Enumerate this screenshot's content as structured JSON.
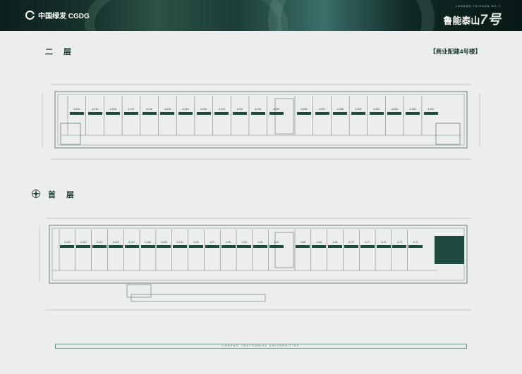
{
  "header": {
    "brand": "中国绿发 CGDG",
    "project_subtitle": "LUNENG TAISHAN NO.7",
    "project_name": "鲁能泰山",
    "project_number": "7号",
    "colors": {
      "header_dark": "#0d1f1d",
      "accent_green": "#1f4a3f",
      "page_bg": "#ebeeed"
    }
  },
  "building_tag": "【商业配建4号楼】",
  "floors": [
    {
      "title": "二 层",
      "units": [
        {
          "id": "4-220",
          "area": ""
        },
        {
          "id": "4-219",
          "area": ""
        },
        {
          "id": "4-218",
          "area": ""
        },
        {
          "id": "4-217",
          "area": ""
        },
        {
          "id": "4-216",
          "area": ""
        },
        {
          "id": "4-215",
          "area": ""
        },
        {
          "id": "4-214",
          "area": ""
        },
        {
          "id": "4-213",
          "area": ""
        },
        {
          "id": "4-212",
          "area": ""
        },
        {
          "id": "4-211",
          "area": ""
        },
        {
          "id": "4-210",
          "area": ""
        },
        {
          "id": "4-209",
          "area": ""
        },
        {
          "id": "4-208",
          "area": ""
        },
        {
          "id": "4-207",
          "area": ""
        },
        {
          "id": "4-206",
          "area": ""
        },
        {
          "id": "4-205",
          "area": ""
        },
        {
          "id": "4-204",
          "area": ""
        },
        {
          "id": "4-203",
          "area": ""
        },
        {
          "id": "4-202",
          "area": ""
        },
        {
          "id": "4-201",
          "area": ""
        }
      ]
    },
    {
      "title": "首 层",
      "units": [
        {
          "id": "4-115",
          "area": ""
        },
        {
          "id": "4-113",
          "area": ""
        },
        {
          "id": "4-111",
          "area": ""
        },
        {
          "id": "4-109",
          "area": ""
        },
        {
          "id": "4-107",
          "area": ""
        },
        {
          "id": "4-105",
          "area": ""
        },
        {
          "id": "4-103",
          "area": ""
        },
        {
          "id": "4-101",
          "area": ""
        },
        {
          "id": "4-99",
          "area": ""
        },
        {
          "id": "4-97",
          "area": ""
        },
        {
          "id": "4-95",
          "area": ""
        },
        {
          "id": "4-93",
          "area": ""
        },
        {
          "id": "4-91",
          "area": ""
        },
        {
          "id": "4-87",
          "area": ""
        },
        {
          "id": "4-85",
          "area": ""
        },
        {
          "id": "4-83",
          "area": ""
        },
        {
          "id": "4-81",
          "area": ""
        },
        {
          "id": "4-79",
          "area": ""
        },
        {
          "id": "4-77",
          "area": ""
        },
        {
          "id": "4-75",
          "area": ""
        },
        {
          "id": "4-73",
          "area": ""
        },
        {
          "id": "4-71",
          "area": ""
        }
      ]
    }
  ],
  "footer_text": "LUNENG  CENTENNIAL  UNIVERSITIES"
}
